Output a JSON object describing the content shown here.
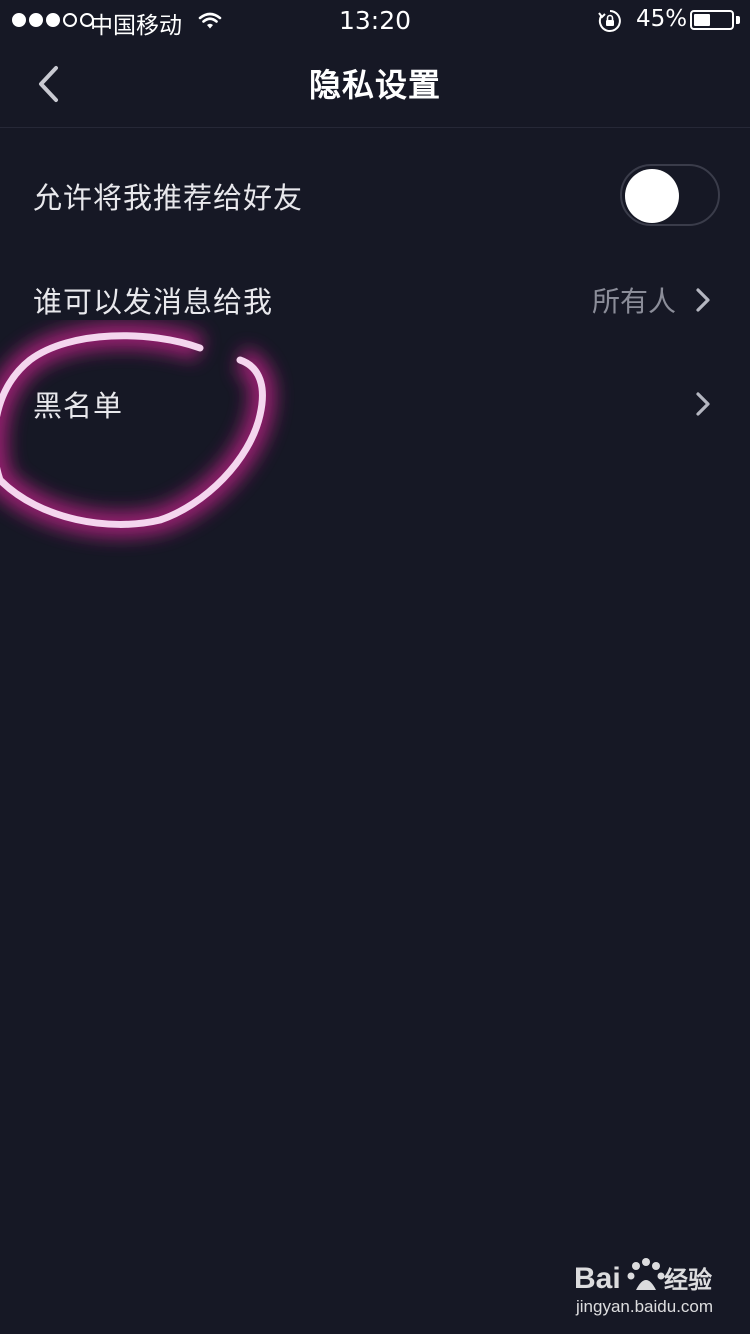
{
  "status_bar": {
    "carrier": "中国移动",
    "time": "13:20",
    "battery_percent_text": "45%",
    "battery_level": 0.45,
    "signal_bars_filled": 3,
    "signal_bars_total": 5
  },
  "nav": {
    "title": "隐私设置",
    "back_icon": "chevron-left-icon"
  },
  "settings": {
    "recommend": {
      "label": "允许将我推荐给好友",
      "toggle_on": false
    },
    "messages": {
      "label": "谁可以发消息给我",
      "value": "所有人"
    },
    "blacklist": {
      "label": "黑名单"
    }
  },
  "colors": {
    "background": "#161825",
    "divider": "#262837",
    "secondary_text": "#8b8d99",
    "annotation_stroke": "#f4d6ee",
    "annotation_glow": "#b0207f"
  },
  "watermark": {
    "brand": "Bai 经验",
    "url": "jingyan.baidu.com"
  }
}
